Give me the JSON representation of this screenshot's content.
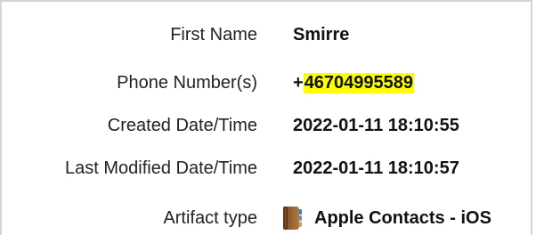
{
  "fields": {
    "first_name": {
      "label": "First Name",
      "value": "Smirre"
    },
    "phone_numbers": {
      "label": "Phone Number(s)",
      "value_prefix": "+",
      "value_highlighted": "46704995589"
    },
    "created": {
      "label": "Created Date/Time",
      "value": "2022-01-11 18:10:55"
    },
    "last_modified": {
      "label": "Last Modified Date/Time",
      "value": "2022-01-11 18:10:57"
    },
    "artifact_type": {
      "label": "Artifact type",
      "value": "Apple Contacts - iOS",
      "icon": "contacts-app-icon"
    }
  },
  "colors": {
    "highlight": "#ffff00",
    "border": "#d4d4d4"
  }
}
